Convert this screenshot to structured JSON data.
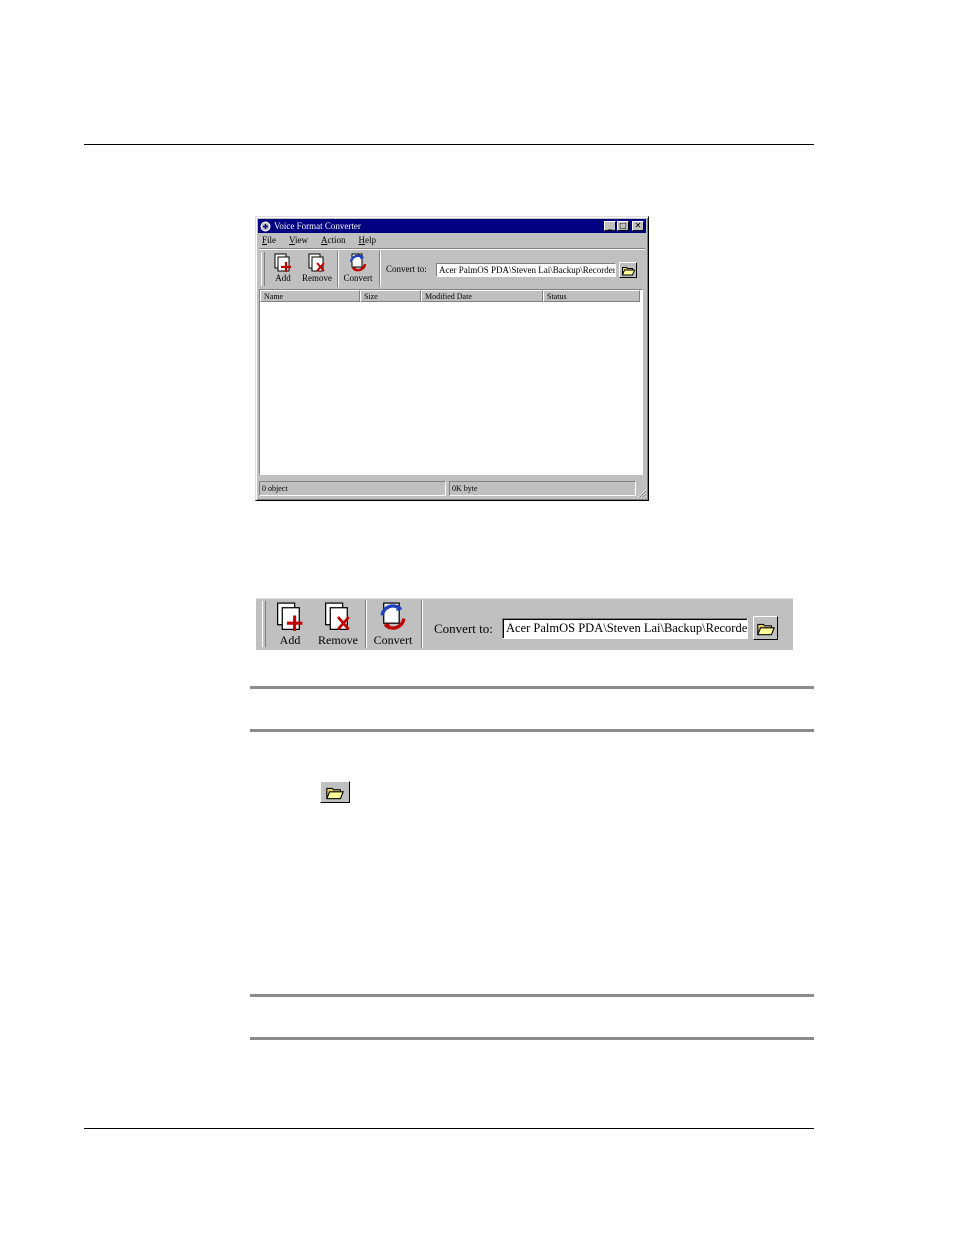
{
  "window": {
    "title": "Voice Format Converter",
    "menu": [
      "File",
      "View",
      "Action",
      "Help"
    ],
    "toolbar": {
      "add_label": "Add",
      "remove_label": "Remove",
      "convert_label": "Convert",
      "convert_to_label": "Convert to:",
      "path_value": "Acer PalmOS PDA\\Steven Lai\\Backup\\Recorder"
    },
    "list_columns": [
      "Name",
      "Size",
      "Modified Date",
      "Status"
    ],
    "status": {
      "objects": "0 object",
      "bytes": "0K byte"
    }
  },
  "toolbar_closeup": {
    "add_label": "Add",
    "remove_label": "Remove",
    "convert_label": "Convert",
    "convert_to_label": "Convert to:",
    "path_value": "Acer PalmOS PDA\\Steven Lai\\Backup\\Recorder"
  },
  "icons": {
    "add": "add-file-icon",
    "remove": "remove-file-icon",
    "convert": "convert-icon",
    "browse": "open-folder-icon"
  }
}
